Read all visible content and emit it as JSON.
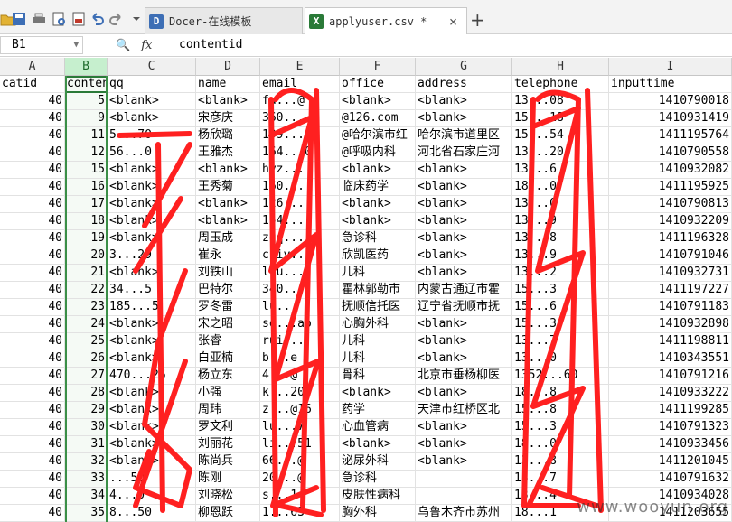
{
  "toolbar": {
    "tabs": [
      {
        "label": "Docer-在线模板",
        "icon": "D"
      },
      {
        "label": "applyuser.csv *",
        "icon": "X"
      }
    ],
    "new_tab_label": "+",
    "close_label": "×"
  },
  "formula_bar": {
    "cell_ref": "B1",
    "fx_label": "fx",
    "content": "contentid"
  },
  "columns": [
    "A",
    "B",
    "C",
    "D",
    "E",
    "F",
    "G",
    "H",
    "I"
  ],
  "header_row": [
    "catid",
    "contentid",
    "qq",
    "name",
    "email",
    "office",
    "address",
    "telephone",
    "inputtime"
  ],
  "rows": [
    [
      "40",
      "5",
      "<blank>",
      "<blank>",
      "fu...@",
      "<blank>",
      "<blank>",
      "13...08",
      "1410790018"
    ],
    [
      "40",
      "9",
      "<blank>",
      "宋彦庆",
      "360...",
      "@126.com",
      "<blank>",
      "15...18",
      "1410931419"
    ],
    [
      "40",
      "11",
      "5...70",
      "杨欣璐",
      "199...",
      "@哈尔滨市红",
      "哈尔滨市道里区",
      "15...54",
      "1411195764"
    ],
    [
      "40",
      "12",
      "56...0",
      "王雅杰",
      "164...0",
      "@呼吸内科",
      "河北省石家庄河",
      "13...20",
      "1410790558"
    ],
    [
      "40",
      "15",
      "<blank>",
      "<blank>",
      "hyz...",
      "<blank>",
      "<blank>",
      "13...6",
      "1410932082"
    ],
    [
      "40",
      "16",
      "<blank>",
      "王秀菊",
      "160...",
      "临床药学",
      "<blank>",
      "18...0",
      "1411195925"
    ],
    [
      "40",
      "17",
      "<blank>",
      "<blank>",
      "126...",
      "<blank>",
      "<blank>",
      "13...0",
      "1410790813"
    ],
    [
      "40",
      "18",
      "<blank>",
      "<blank>",
      "154...",
      "<blank>",
      "<blank>",
      "13...9",
      "1410932209"
    ],
    [
      "40",
      "19",
      "<blank>",
      "周玉成",
      "zqq...",
      "急诊科",
      "<blank>",
      "13...8",
      "1411196328"
    ],
    [
      "40",
      "20",
      "3...29",
      "崔永",
      "cuiy...",
      "欣凯医药",
      "<blank>",
      "13...9",
      "1410791046"
    ],
    [
      "40",
      "21",
      "<blank>",
      "刘铁山",
      "liu...l",
      "儿科",
      "<blank>",
      "13...2",
      "1410932731"
    ],
    [
      "40",
      "22",
      "34...5",
      "巴特尔",
      "340...",
      "霍林郭勒市",
      "内蒙古通辽市霍",
      "15...3",
      "1411197227"
    ],
    [
      "40",
      "23",
      "185...5",
      "罗冬雷",
      "lu...",
      "抚顺信托医",
      "辽宁省抚顺市抚",
      "15...6",
      "1410791183"
    ],
    [
      "40",
      "24",
      "<blank>",
      "宋之昭",
      "so...ao",
      "心胸外科",
      "<blank>",
      "15...3",
      "1410932898"
    ],
    [
      "40",
      "25",
      "<blank>",
      "张睿",
      "rui...",
      "儿科",
      "<blank>",
      "13...7",
      "1411198811"
    ],
    [
      "40",
      "26",
      "<blank>",
      "白亚楠",
      "b...e",
      "儿科",
      "<blank>",
      "13...0",
      "1410343551"
    ],
    [
      "40",
      "27",
      "470...26",
      "杨立东",
      "4...@",
      "骨科",
      "北京市垂杨柳医",
      "1352...60",
      "1410791216"
    ],
    [
      "40",
      "28",
      "<blank>",
      "小强",
      "k...20",
      "<blank>",
      "<blank>",
      "18...8",
      "1410933222"
    ],
    [
      "40",
      "29",
      "<blank>",
      "周玮",
      "z...@16",
      "药学",
      "天津市红桥区北",
      "15...8",
      "1411199285"
    ],
    [
      "40",
      "30",
      "<blank>",
      "罗文利",
      "lu...7",
      "心血管病",
      "<blank>",
      "15...3",
      "1410791323"
    ],
    [
      "40",
      "31",
      "<blank>",
      "刘丽花",
      "li...51",
      "<blank>",
      "<blank>",
      "18...0",
      "1410933456"
    ],
    [
      "40",
      "32",
      "<blank>",
      "陈尚兵",
      "66...@",
      "泌尿外科",
      "<blank>",
      "13...8",
      "1411201045"
    ],
    [
      "40",
      "33",
      "...50",
      "陈刚",
      "20...@",
      "急诊科",
      "",
      "13...7",
      "1410791632"
    ],
    [
      "40",
      "34",
      "4...0",
      "刘晓松",
      "s...1",
      "皮肤性病科",
      "",
      "13...4",
      "1410934028"
    ],
    [
      "40",
      "35",
      "8...50",
      "柳恩跃",
      "1...63",
      "胸外科",
      "乌鲁木齐市苏州",
      "18...1",
      "1411203655"
    ]
  ],
  "watermark": "www.wooyun.org",
  "colors": {
    "accent": "#2a7a38",
    "scribble": "#ff2020"
  }
}
